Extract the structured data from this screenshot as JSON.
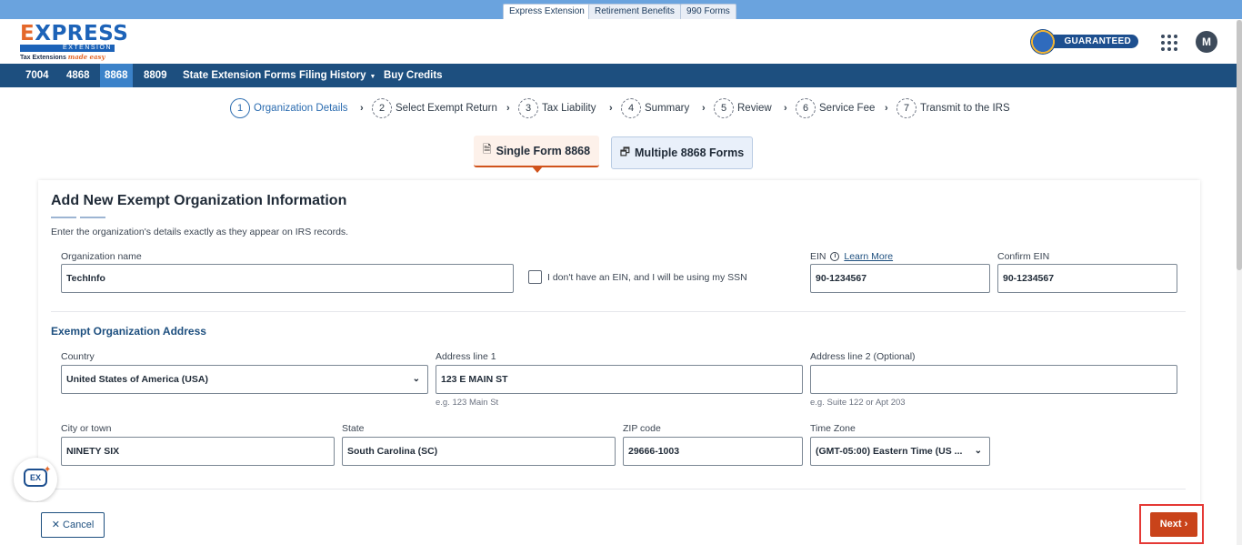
{
  "product_tabs": [
    {
      "label": "Express Extension",
      "active": true
    },
    {
      "label": "Retirement Benefits",
      "active": false
    },
    {
      "label": "990 Forms",
      "active": false
    }
  ],
  "brand": {
    "logo_main": "XPRESS",
    "logo_letter": "E",
    "logo_bar": "EXTENSION",
    "tagline_plain": "Tax Extensions",
    "tagline_script": "made easy",
    "guarantee_badge": "GUARANTEED",
    "guarantee_seal_text": "EXTENSION"
  },
  "header": {
    "avatar_initial": "M",
    "apps_icon": "apps-grid-icon"
  },
  "nav": {
    "items": [
      "7004",
      "4868",
      "8868",
      "8809",
      "State Extension Forms",
      "Filing History",
      "Buy Credits"
    ],
    "active": "8868",
    "dropdown_item": "Filing History"
  },
  "steps": [
    {
      "num": "1",
      "label": "Organization Details"
    },
    {
      "num": "2",
      "label": "Select Exempt Return"
    },
    {
      "num": "3",
      "label": "Tax Liability"
    },
    {
      "num": "4",
      "label": "Summary"
    },
    {
      "num": "5",
      "label": "Review"
    },
    {
      "num": "6",
      "label": "Service Fee"
    },
    {
      "num": "7",
      "label": "Transmit to the IRS"
    }
  ],
  "form_tabs": {
    "single": "Single Form 8868",
    "multiple": "Multiple 8868 Forms"
  },
  "card": {
    "title": "Add New Exempt Organization Information",
    "description": "Enter the organization's details exactly as they appear on IRS records.",
    "org_name_label": "Organization name",
    "org_name_value": "TechInfo",
    "no_ein_label": "I don't have an EIN, and I will be using my SSN",
    "ein_label": "EIN",
    "ein_learn_more": "Learn More",
    "ein_value": "90-1234567",
    "confirm_ein_label": "Confirm EIN",
    "confirm_ein_value": "90-1234567",
    "address_section": "Exempt Organization Address",
    "country_label": "Country",
    "country_value": "United States of America (USA)",
    "address1_label": "Address line 1",
    "address1_value": "123 E MAIN ST",
    "address1_hint": "e.g. 123 Main St",
    "address2_label": "Address line 2 (Optional)",
    "address2_value": "",
    "address2_hint": "e.g. Suite 122 or Apt 203",
    "city_label": "City or town",
    "city_value": "NINETY SIX",
    "state_label": "State",
    "state_value": "South Carolina (SC)",
    "zip_label": "ZIP code",
    "zip_value": "29666-1003",
    "timezone_label": "Time Zone",
    "timezone_value": "(GMT-05:00) Eastern Time (US ..."
  },
  "chat": {
    "badge": "EX"
  },
  "footer": {
    "cancel": "Cancel",
    "next": "Next"
  },
  "colors": {
    "nav_bg": "#1d4f7f",
    "nav_active": "#3b82c9",
    "accent": "#c9431a",
    "highlight": "#e53935",
    "brand_blue": "#1d63b8",
    "brand_orange": "#e4682a"
  }
}
